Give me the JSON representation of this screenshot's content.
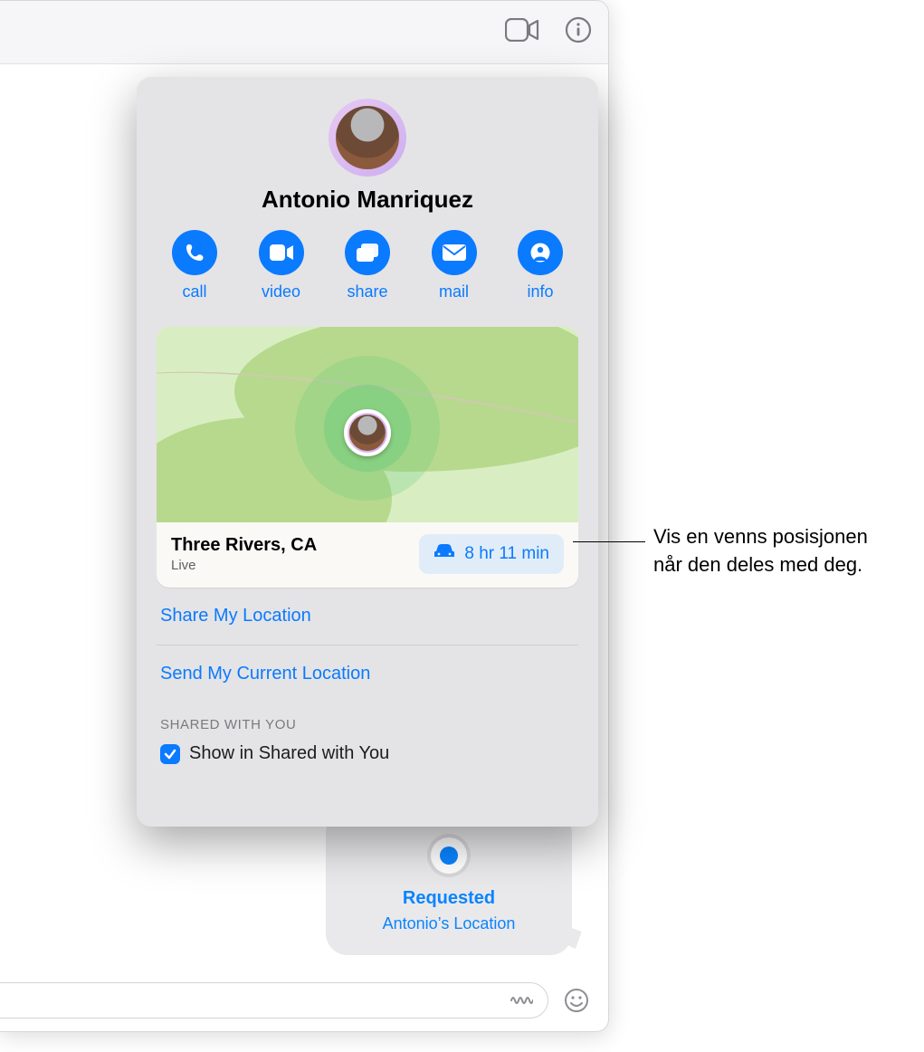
{
  "toolbar": {
    "video_icon": "video-icon",
    "info_icon": "info-icon"
  },
  "popover": {
    "contact_name": "Antonio Manriquez",
    "actions": {
      "call": "call",
      "video": "video",
      "share": "share",
      "mail": "mail",
      "info": "info"
    },
    "location": {
      "city": "Three Rivers, CA",
      "status": "Live",
      "eta": "8 hr 11 min"
    },
    "share_my_location": "Share My Location",
    "send_current_location": "Send My Current Location",
    "section_shared": "SHARED WITH YOU",
    "show_in_shared": "Show in Shared with You"
  },
  "bubble": {
    "title": "Requested",
    "subtitle": "Antonio’s Location"
  },
  "callout": {
    "line1": "Vis en venns posisjonen",
    "line2": "når den deles med deg."
  }
}
